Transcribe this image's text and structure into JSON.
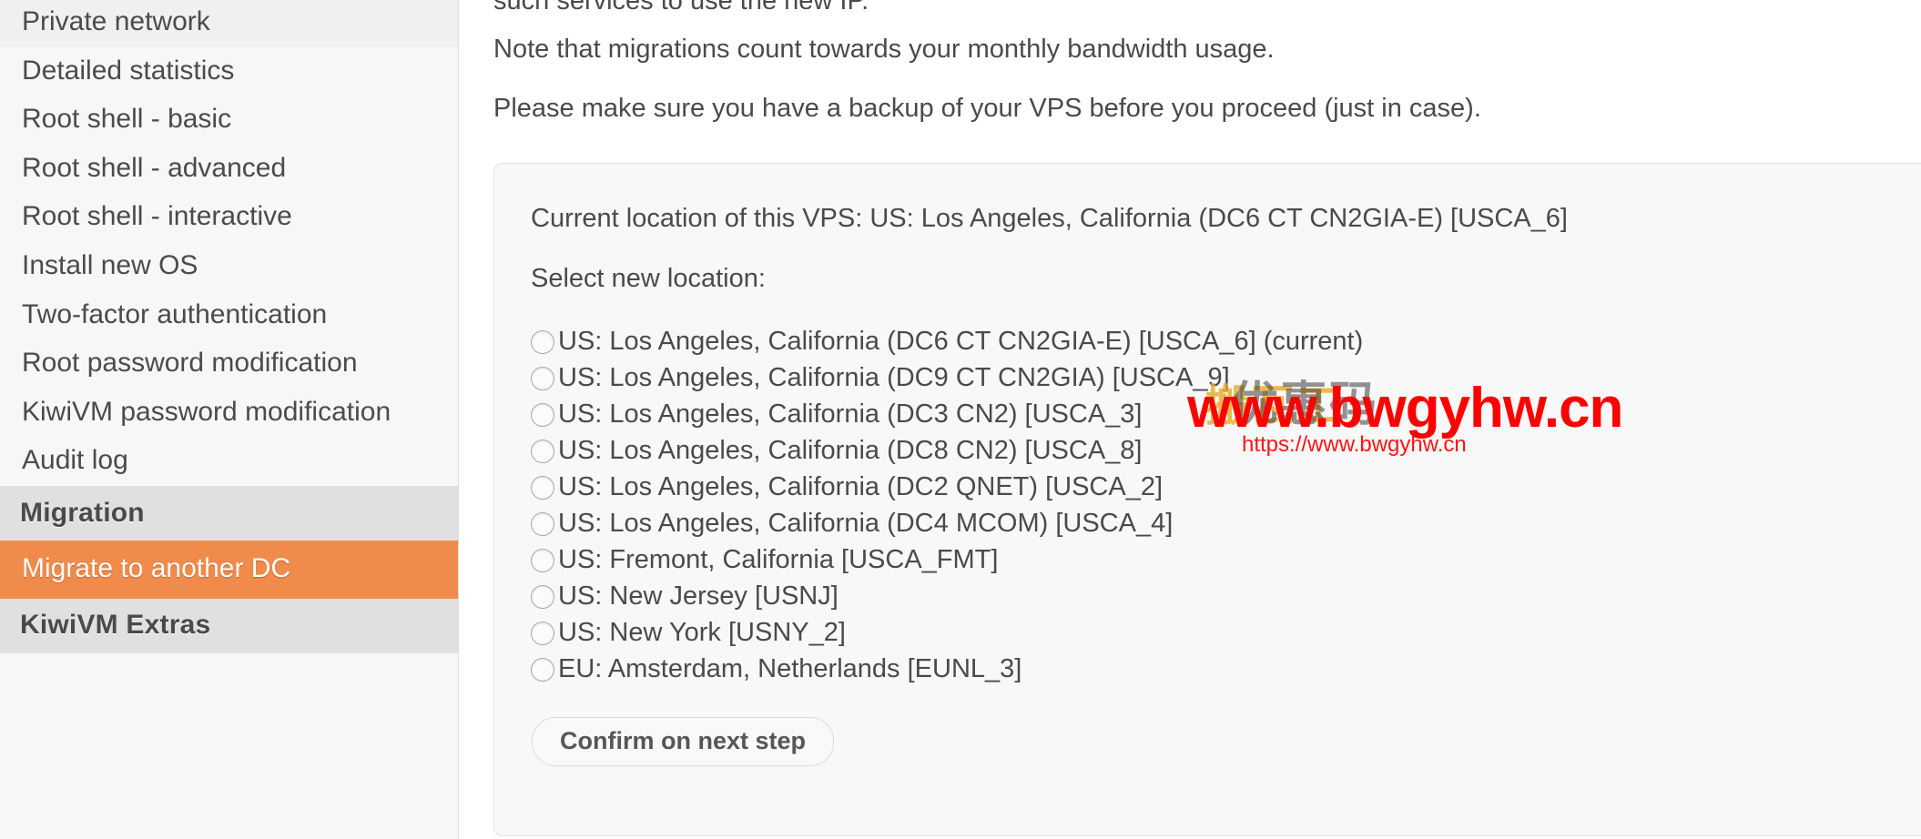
{
  "sidebar": {
    "items": [
      {
        "label": "Private network",
        "type": "link",
        "active": false
      },
      {
        "label": "Detailed statistics",
        "type": "link",
        "active": false
      },
      {
        "label": "Root shell - basic",
        "type": "link",
        "active": false
      },
      {
        "label": "Root shell - advanced",
        "type": "link",
        "active": false
      },
      {
        "label": "Root shell - interactive",
        "type": "link",
        "active": false
      },
      {
        "label": "Install new OS",
        "type": "link",
        "active": false
      },
      {
        "label": "Two-factor authentication",
        "type": "link",
        "active": false
      },
      {
        "label": "Root password modification",
        "type": "link",
        "active": false
      },
      {
        "label": "KiwiVM password modification",
        "type": "link",
        "active": false
      },
      {
        "label": "Audit log",
        "type": "link",
        "active": false
      },
      {
        "label": "Migration",
        "type": "header",
        "active": false
      },
      {
        "label": "Migrate to another DC",
        "type": "link",
        "active": true
      },
      {
        "label": "KiwiVM Extras",
        "type": "header",
        "active": false
      }
    ]
  },
  "main": {
    "intro": {
      "clipped_line": "such services to use the new IP.",
      "para2": "Note that migrations count towards your monthly bandwidth usage.",
      "para3": "Please make sure you have a backup of your VPS before you proceed (just in case)."
    },
    "panel": {
      "current_location": "Current location of this VPS: US: Los Angeles, California (DC6 CT CN2GIA-E) [USCA_6]",
      "select_label": "Select new location:",
      "locations": [
        {
          "label": "US: Los Angeles, California (DC6 CT CN2GIA-E) [USCA_6] (current)",
          "selected": false
        },
        {
          "label": "US: Los Angeles, California (DC9 CT CN2GIA) [USCA_9]",
          "selected": false
        },
        {
          "label": "US: Los Angeles, California (DC3 CN2) [USCA_3]",
          "selected": false
        },
        {
          "label": "US: Los Angeles, California (DC8 CN2) [USCA_8]",
          "selected": false
        },
        {
          "label": "US: Los Angeles, California (DC2 QNET) [USCA_2]",
          "selected": false
        },
        {
          "label": "US: Los Angeles, California (DC4 MCOM) [USCA_4]",
          "selected": false
        },
        {
          "label": "US: Fremont, California [USCA_FMT]",
          "selected": false
        },
        {
          "label": "US: New Jersey [USNJ]",
          "selected": false
        },
        {
          "label": "US: New York [USNY_2]",
          "selected": false
        },
        {
          "label": "EU: Amsterdam, Netherlands [EUNL_3]",
          "selected": false
        }
      ],
      "confirm_button": "Confirm on next step"
    }
  },
  "watermark": {
    "main": "www.bwgyhw.cn",
    "sub": "https://www.bwgyhw.cn",
    "cn_dark": "优惠码",
    "cn_gold": "搬瓦工"
  },
  "colors": {
    "accent_orange": "#f08b4c",
    "sidebar_bg": "#f7f7f7",
    "header_bg": "#e0e0e0",
    "panel_bg": "#f8f8f8",
    "text": "#4a4a4a",
    "watermark_red": "#ff0000"
  }
}
